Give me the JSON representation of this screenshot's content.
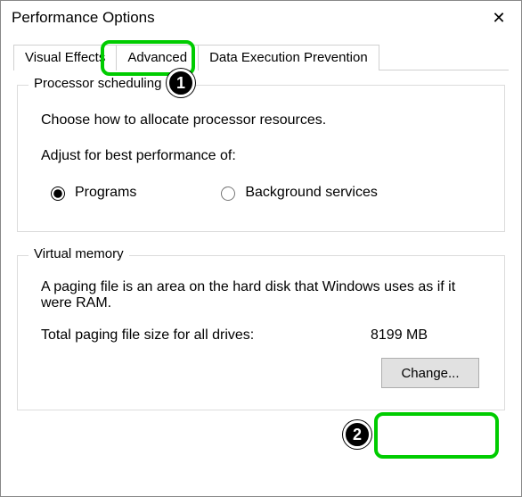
{
  "window": {
    "title": "Performance Options",
    "close_glyph": "✕"
  },
  "tabs": {
    "visual_effects": "Visual Effects",
    "advanced": "Advanced",
    "dep": "Data Execution Prevention"
  },
  "processor": {
    "legend": "Processor scheduling",
    "description": "Choose how to allocate processor resources.",
    "adjust_label": "Adjust for best performance of:",
    "programs_label": "Programs",
    "background_label": "Background services"
  },
  "virtual_memory": {
    "legend": "Virtual memory",
    "description": "A paging file is an area on the hard disk that Windows uses as if it were RAM.",
    "total_label": "Total paging file size for all drives:",
    "total_value": "8199 MB",
    "change_label": "Change..."
  },
  "annotations": {
    "badge1": "1",
    "badge2": "2"
  }
}
